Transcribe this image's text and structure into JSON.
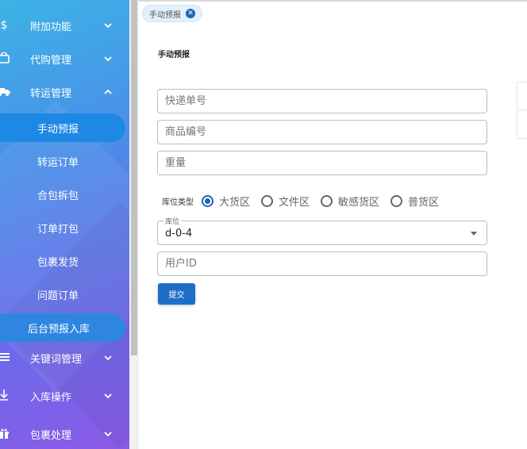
{
  "sidebar": {
    "items": [
      {
        "label": "附加功能",
        "icon": "dollar-icon",
        "expanded": false
      },
      {
        "label": "代购管理",
        "icon": "shopping-bag-icon",
        "expanded": false
      },
      {
        "label": "转运管理",
        "icon": "truck-icon",
        "expanded": true
      },
      {
        "label": "关键词管理",
        "icon": "menu-icon",
        "expanded": false
      },
      {
        "label": "入库操作",
        "icon": "download-arrow-icon",
        "expanded": false
      },
      {
        "label": "包裹处理",
        "icon": "gift-icon",
        "expanded": false
      }
    ],
    "sub_items": [
      {
        "label": "手动预报",
        "active": true
      },
      {
        "label": "转运订单"
      },
      {
        "label": "合包拆包"
      },
      {
        "label": "订单打包"
      },
      {
        "label": "包裹发货"
      },
      {
        "label": "问题订单"
      },
      {
        "label": "后台预报入库",
        "highlight": true
      }
    ]
  },
  "tabs": [
    {
      "label": "手动预报",
      "closable": true
    }
  ],
  "page": {
    "title": "手动预报"
  },
  "form": {
    "tracking_placeholder": "快递单号",
    "product_placeholder": "商品编号",
    "weight_placeholder": "重量",
    "warehouse_type_label": "库位类型",
    "warehouse_types": [
      "大货区",
      "文件区",
      "敏感货区",
      "普货区"
    ],
    "warehouse_type_selected": "大货区",
    "location_label": "库位",
    "location_value": "d-0-4",
    "user_id_placeholder": "用户ID",
    "submit_label": "提交"
  },
  "colors": {
    "accent": "#1e6ec8",
    "sidebar_top": "#3cb3e6",
    "sidebar_bottom": "#8b5ae6"
  }
}
